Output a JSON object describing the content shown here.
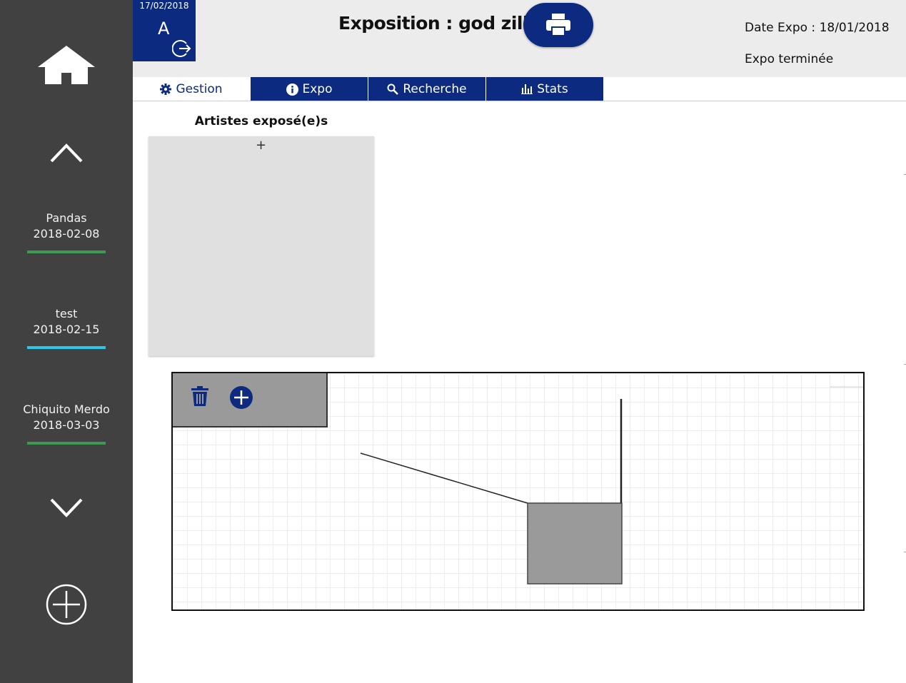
{
  "sidebar": {
    "expos": [
      {
        "name": "Pandas",
        "date": "2018-02-08",
        "color": "#3c9a52"
      },
      {
        "name": "test",
        "date": "2018-02-15",
        "color": "#27c8e8"
      },
      {
        "name": "Chiquito Merdo",
        "date": "2018-03-03",
        "color": "#3c9a52"
      }
    ]
  },
  "user": {
    "date": "17/02/2018",
    "initial": "A"
  },
  "header": {
    "title": "Exposition : god zilla",
    "expo_date": "Date Expo : 18/01/2018",
    "status": "Expo terminée"
  },
  "tabs": [
    {
      "label": "Gestion",
      "icon": "gear-icon",
      "active": true
    },
    {
      "label": "Expo",
      "icon": "info-icon",
      "active": false
    },
    {
      "label": "Recherche",
      "icon": "search-icon",
      "active": false
    },
    {
      "label": "Stats",
      "icon": "stats-icon",
      "active": false
    }
  ],
  "artists": {
    "title": "Artistes exposé(e)s",
    "add": "+"
  },
  "colors": {
    "primary": "#0b2a80",
    "sidebar": "#414141",
    "header": "#ececec"
  }
}
